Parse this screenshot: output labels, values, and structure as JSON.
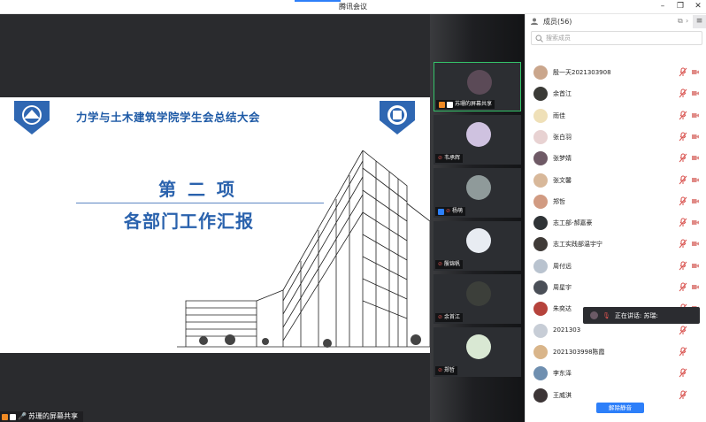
{
  "window": {
    "title": "腾讯会议"
  },
  "slide": {
    "subtitle": "力学与土木建筑学院学生会总结大会",
    "heading": "第 二 项",
    "subheading": "各部门工作汇报"
  },
  "screen_share_label": "苏珊的屏幕共享",
  "video_tiles": [
    {
      "name": "苏珊的屏幕共享",
      "avatar_color": "#5b4a57"
    },
    {
      "name": "韦承辉",
      "avatar_color": "#cfc2e0"
    },
    {
      "name": "杨萌",
      "avatar_color": "#8f9a9a"
    },
    {
      "name": "殷锦帆",
      "avatar_color": "#e8ecf2"
    },
    {
      "name": "余首江",
      "avatar_color": "#3c3f3a"
    },
    {
      "name": "郑哲",
      "avatar_color": "#d9e8d3"
    }
  ],
  "panel": {
    "title": "成员(56)",
    "search_placeholder": "搜索成员",
    "members": [
      {
        "name": "殷一天2021303908",
        "color": "#caa68c"
      },
      {
        "name": "余首江",
        "color": "#3a3a36"
      },
      {
        "name": "雨佳",
        "color": "#efe0b8"
      },
      {
        "name": "张白羽",
        "color": "#e8d2d2"
      },
      {
        "name": "张梦婧",
        "color": "#6f5a66"
      },
      {
        "name": "张文馨",
        "color": "#d8b89a"
      },
      {
        "name": "郑哲",
        "color": "#d19b82"
      },
      {
        "name": "志工部-郝嘉豪",
        "color": "#2f3336"
      },
      {
        "name": "志工实践部温宇宁",
        "color": "#3f3a37"
      },
      {
        "name": "周付远",
        "color": "#b9c3cf"
      },
      {
        "name": "周星宇",
        "color": "#4a4f57"
      },
      {
        "name": "朱奕达",
        "color": "#b6433c"
      },
      {
        "name": "2021303",
        "color": "#c7cdd6"
      },
      {
        "name": "2021303998陈霞",
        "color": "#d9b58a"
      },
      {
        "name": "李东泽",
        "color": "#6f8fb0"
      },
      {
        "name": "王威淇",
        "color": "#3c3536"
      }
    ],
    "speaking_label": "正在讲话: 苏瑞:",
    "unmute_button": "解除静音"
  },
  "colors": {
    "accent": "#2d7ff9",
    "slide_blue": "#2a62ad",
    "muted_red": "#d9534f"
  }
}
